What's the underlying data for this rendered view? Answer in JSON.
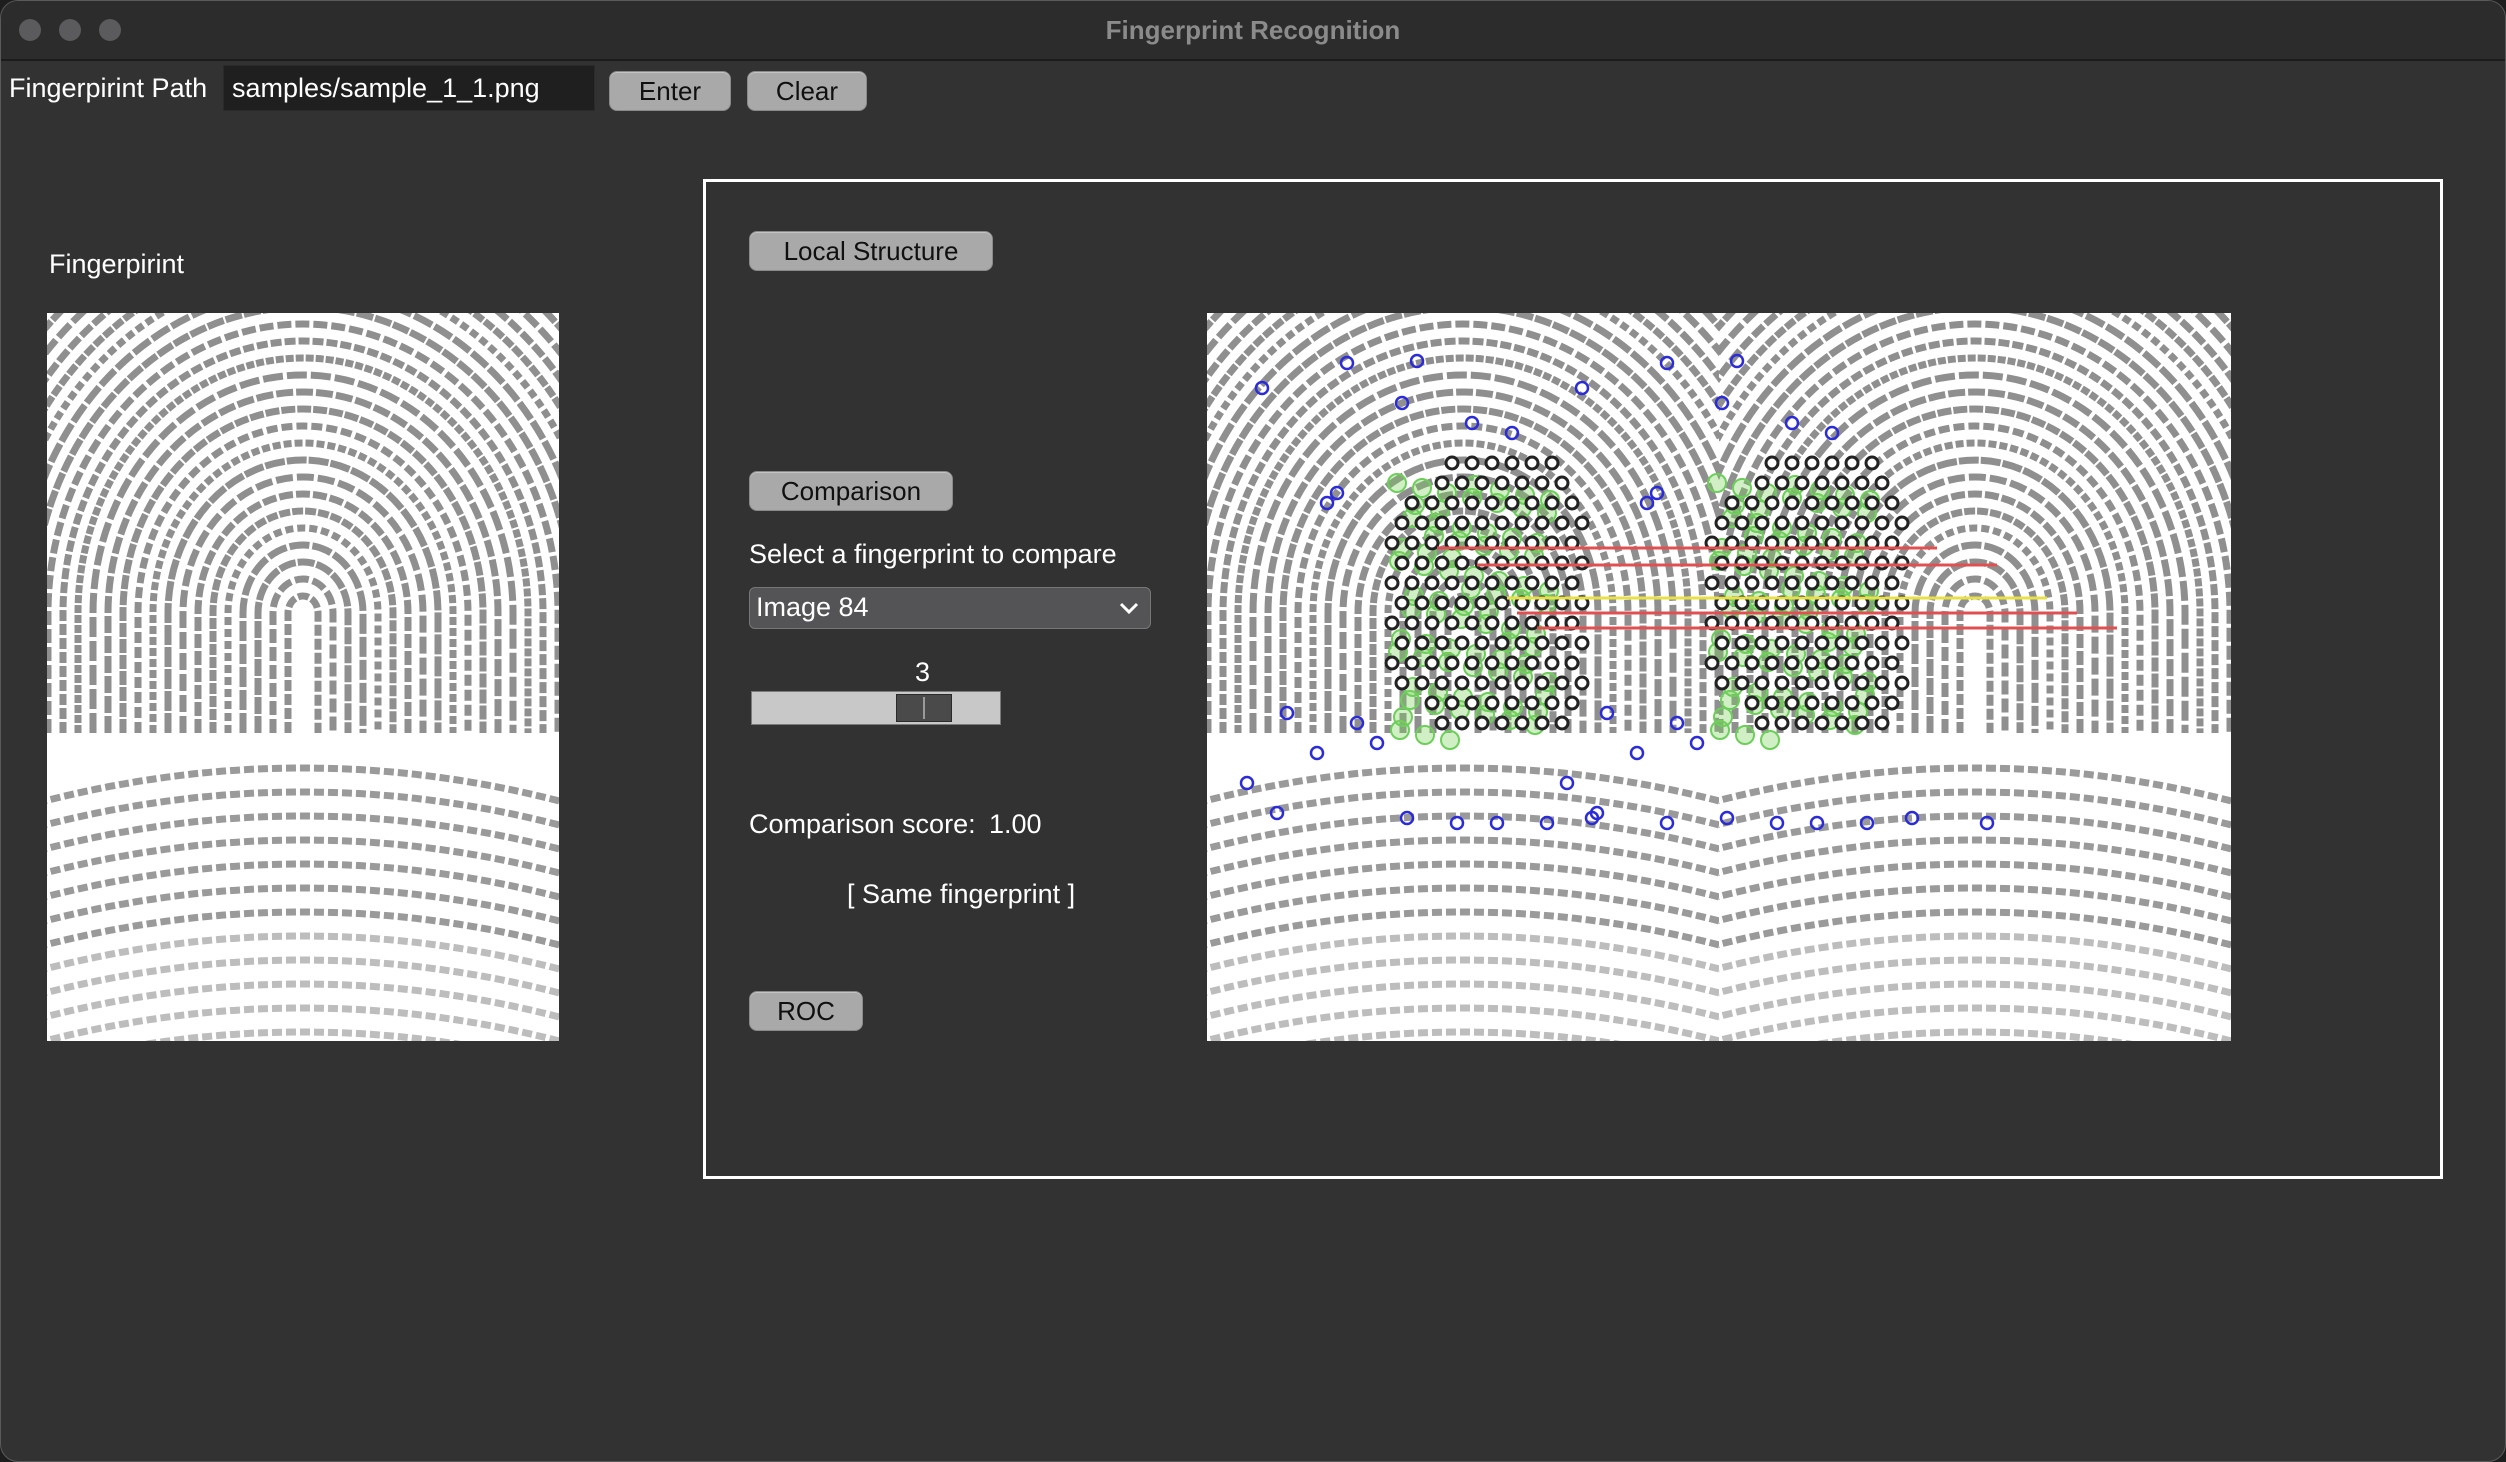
{
  "window": {
    "title": "Fingerprint Recognition"
  },
  "toolbar": {
    "path_label": "Fingerpirint Path",
    "path_value": "samples/sample_1_1.png",
    "enter_label": "Enter",
    "clear_label": "Clear"
  },
  "left": {
    "heading": "Fingerpirint"
  },
  "panel": {
    "local_structure_label": "Local Structure",
    "comparison_label": "Comparison",
    "select_prompt": "Select a fingerprint to compare",
    "selected_image": "Image 84",
    "slider_value_text": "3",
    "score_label": "Comparison score:",
    "score_value": "1.00",
    "verdict": "[ Same fingerprint ]",
    "roc_label": "ROC"
  }
}
